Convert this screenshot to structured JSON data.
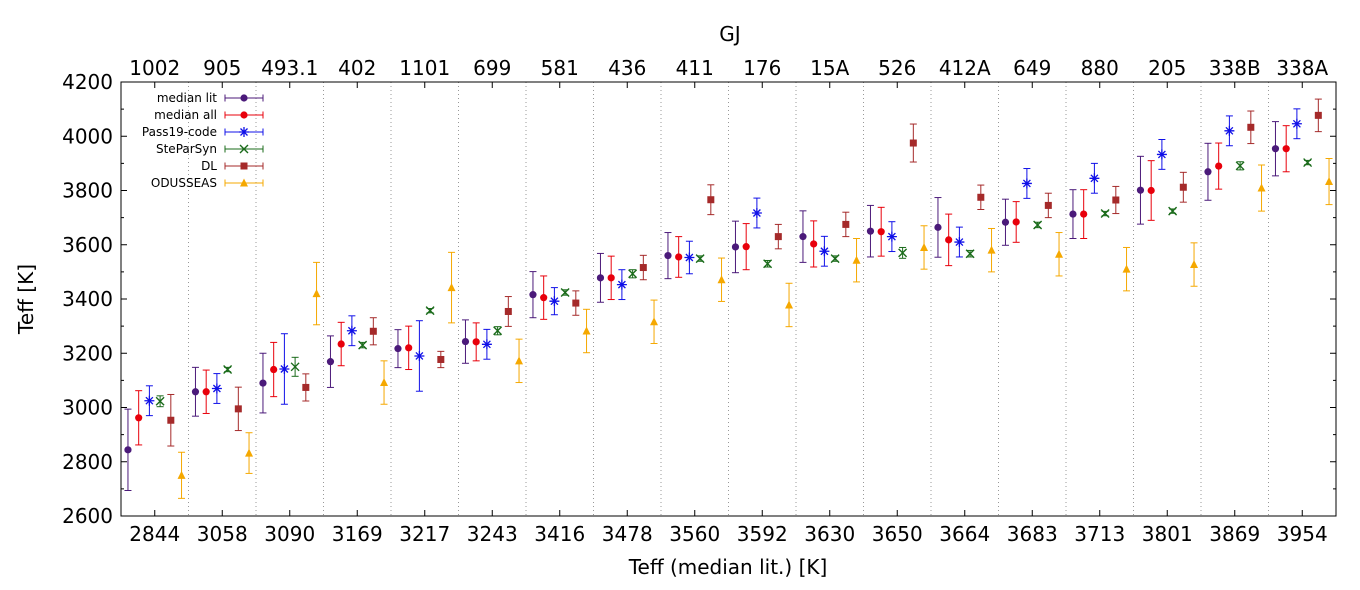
{
  "chart_data": {
    "type": "scatter",
    "title": "",
    "top_axis_label": "GJ",
    "xlabel": "Teff (median lit.) [K]",
    "ylabel": "Teff [K]",
    "ylim": [
      2600,
      4200
    ],
    "yticks": [
      2600,
      2800,
      3000,
      3200,
      3400,
      3600,
      3800,
      4000,
      4200
    ],
    "categories": [
      "2844",
      "3058",
      "3090",
      "3169",
      "3217",
      "3243",
      "3416",
      "3478",
      "3560",
      "3592",
      "3630",
      "3650",
      "3664",
      "3683",
      "3713",
      "3801",
      "3869",
      "3954"
    ],
    "top_categories": [
      "1002",
      "905",
      "493.1",
      "402",
      "1101",
      "699",
      "581",
      "436",
      "411",
      "176",
      "15A",
      "526",
      "412A",
      "649",
      "880",
      "205",
      "338B",
      "338A"
    ],
    "grid": "vertical dotted separators",
    "legend_position": "top-left",
    "series": [
      {
        "name": "median lit",
        "color": "#4b1a7a",
        "marker": "circle",
        "values": [
          2844,
          3058,
          3090,
          3169,
          3217,
          3243,
          3416,
          3478,
          3560,
          3592,
          3630,
          3650,
          3664,
          3683,
          3713,
          3801,
          3869,
          3954
        ],
        "errors": [
          150,
          90,
          110,
          95,
          70,
          80,
          85,
          90,
          85,
          95,
          95,
          95,
          110,
          85,
          90,
          125,
          105,
          100
        ]
      },
      {
        "name": "median all",
        "color": "#e8000b",
        "marker": "circle",
        "values": [
          2962,
          3058,
          3140,
          3234,
          3220,
          3242,
          3405,
          3478,
          3555,
          3593,
          3603,
          3648,
          3618,
          3684,
          3713,
          3800,
          3890,
          3954
        ],
        "errors": [
          100,
          80,
          100,
          80,
          80,
          70,
          80,
          80,
          75,
          85,
          85,
          90,
          95,
          75,
          90,
          110,
          85,
          85
        ]
      },
      {
        "name": "Pass19-code",
        "color": "#1010e8",
        "marker": "asterisk",
        "values": [
          3025,
          3070,
          3142,
          3283,
          3190,
          3233,
          3392,
          3453,
          3553,
          3717,
          3576,
          3630,
          3610,
          3826,
          3845,
          3933,
          4020,
          4046
        ],
        "errors": [
          55,
          55,
          130,
          55,
          130,
          55,
          50,
          55,
          60,
          55,
          55,
          55,
          55,
          55,
          55,
          55,
          55,
          55
        ]
      },
      {
        "name": "SteParSyn",
        "color": "#1a6b1a",
        "marker": "x",
        "values": [
          3023,
          3140,
          3150,
          3230,
          3357,
          3283,
          3424,
          3493,
          3549,
          3530,
          3549,
          3570,
          3567,
          3673,
          3715,
          3724,
          3891,
          3903
        ],
        "errors": [
          20,
          8,
          35,
          10,
          8,
          15,
          10,
          15,
          10,
          12,
          10,
          20,
          12,
          10,
          8,
          8,
          15,
          8
        ]
      },
      {
        "name": "DL",
        "color": "#a52a2a",
        "marker": "square",
        "values": [
          2953,
          2995,
          3074,
          3281,
          3177,
          3354,
          3385,
          3516,
          3766,
          3630,
          3675,
          3975,
          3775,
          3745,
          3765,
          3812,
          4033,
          4077
        ],
        "errors": [
          95,
          80,
          50,
          50,
          30,
          55,
          45,
          45,
          55,
          45,
          45,
          70,
          45,
          45,
          50,
          55,
          60,
          60
        ]
      },
      {
        "name": "ODUSSEAS",
        "color": "#f5a800",
        "marker": "triangle",
        "values": [
          2750,
          2832,
          3420,
          3092,
          3442,
          3172,
          3282,
          3316,
          3471,
          3378,
          3543,
          3590,
          3580,
          3565,
          3510,
          3527,
          3809,
          3833
        ],
        "errors": [
          85,
          75,
          115,
          80,
          130,
          80,
          80,
          80,
          80,
          80,
          80,
          80,
          80,
          80,
          80,
          80,
          85,
          85
        ]
      }
    ]
  }
}
